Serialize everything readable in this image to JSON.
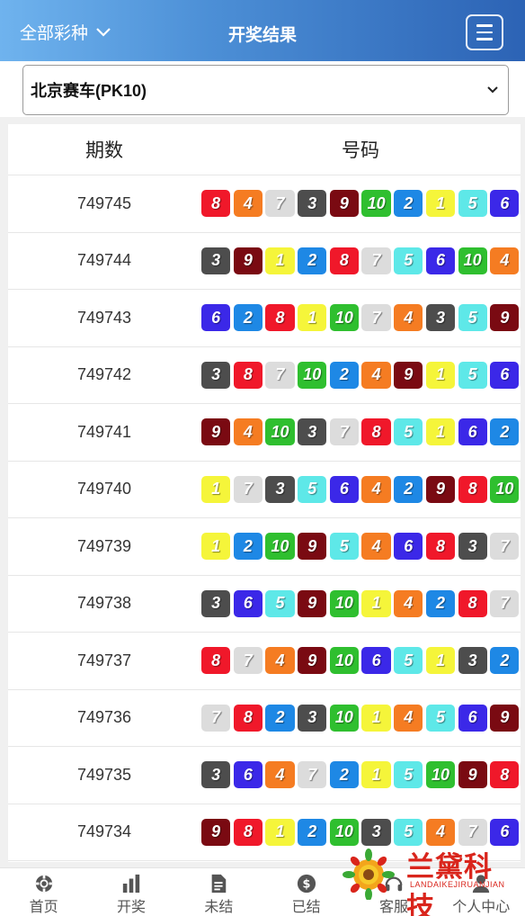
{
  "header": {
    "lottery_selector": "全部彩种",
    "title": "开奖结果"
  },
  "game_select": {
    "selected": "北京赛车(PK10)"
  },
  "table": {
    "col_issue": "期数",
    "col_numbers": "号码",
    "rows": [
      {
        "issue": "749745",
        "numbers": [
          8,
          4,
          7,
          3,
          9,
          10,
          2,
          1,
          5,
          6
        ]
      },
      {
        "issue": "749744",
        "numbers": [
          3,
          9,
          1,
          2,
          8,
          7,
          5,
          6,
          10,
          4
        ]
      },
      {
        "issue": "749743",
        "numbers": [
          6,
          2,
          8,
          1,
          10,
          7,
          4,
          3,
          5,
          9
        ]
      },
      {
        "issue": "749742",
        "numbers": [
          3,
          8,
          7,
          10,
          2,
          4,
          9,
          1,
          5,
          6
        ]
      },
      {
        "issue": "749741",
        "numbers": [
          9,
          4,
          10,
          3,
          7,
          8,
          5,
          1,
          6,
          2
        ]
      },
      {
        "issue": "749740",
        "numbers": [
          1,
          7,
          3,
          5,
          6,
          4,
          2,
          9,
          8,
          10
        ]
      },
      {
        "issue": "749739",
        "numbers": [
          1,
          2,
          10,
          9,
          5,
          4,
          6,
          8,
          3,
          7
        ]
      },
      {
        "issue": "749738",
        "numbers": [
          3,
          6,
          5,
          9,
          10,
          1,
          4,
          2,
          8,
          7
        ]
      },
      {
        "issue": "749737",
        "numbers": [
          8,
          7,
          4,
          9,
          10,
          6,
          5,
          1,
          3,
          2
        ]
      },
      {
        "issue": "749736",
        "numbers": [
          7,
          8,
          2,
          3,
          10,
          1,
          4,
          5,
          6,
          9
        ]
      },
      {
        "issue": "749735",
        "numbers": [
          3,
          6,
          4,
          7,
          2,
          1,
          5,
          10,
          9,
          8
        ]
      },
      {
        "issue": "749734",
        "numbers": [
          9,
          8,
          1,
          2,
          10,
          3,
          5,
          4,
          7,
          6
        ]
      }
    ]
  },
  "ball_colors": {
    "1": "#f5f53a",
    "2": "#1e88e5",
    "3": "#4d4d4d",
    "4": "#f57c22",
    "5": "#5ee8e8",
    "6": "#3b28e8",
    "7": "#dcdcdc",
    "8": "#f0182a",
    "9": "#7a0a12",
    "10": "#2fbf2f"
  },
  "tabbar": [
    {
      "label": "首页",
      "icon": "chip-icon"
    },
    {
      "label": "开奖",
      "icon": "bar-chart-icon"
    },
    {
      "label": "未结",
      "icon": "document-icon"
    },
    {
      "label": "已结",
      "icon": "dollar-icon"
    },
    {
      "label": "客服",
      "icon": "headset-icon"
    },
    {
      "label": "个人中心",
      "icon": "user-icon"
    }
  ],
  "watermark": {
    "name": "兰黛科技",
    "sub": "LANDAIKEJIRUANJIAN"
  }
}
